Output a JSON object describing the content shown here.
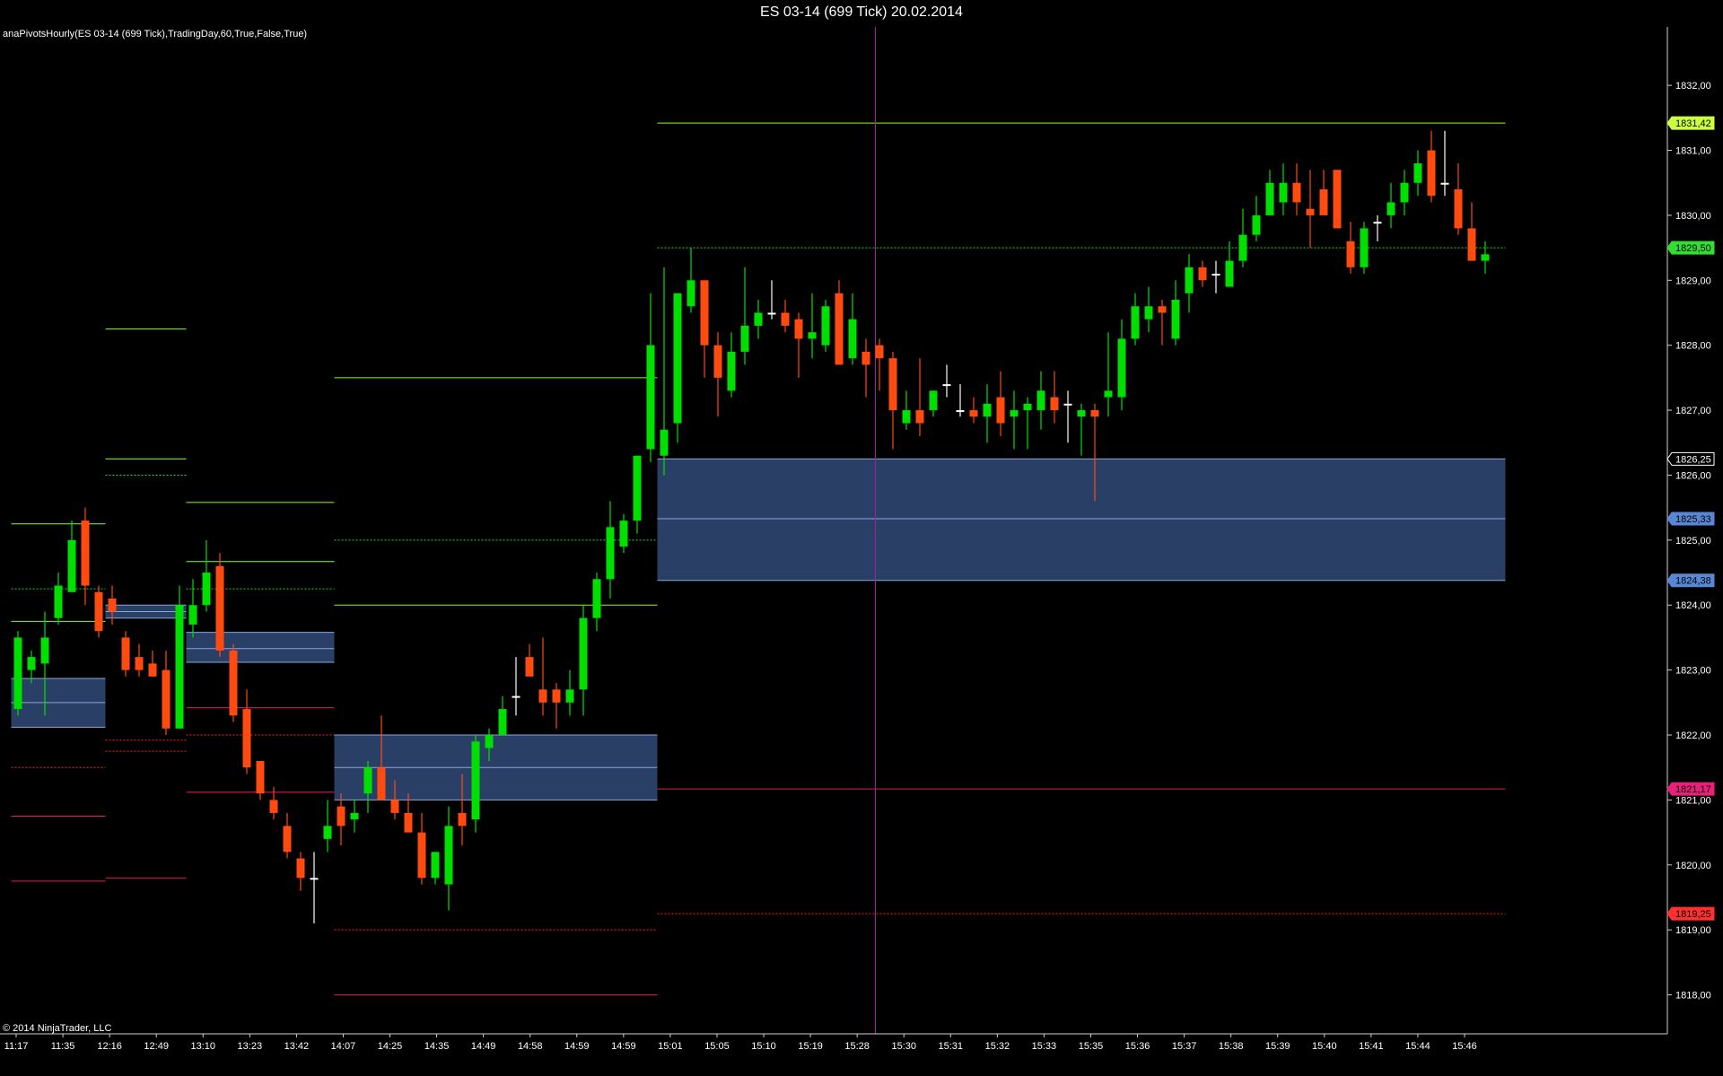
{
  "title": "ES 03-14 (699 Tick)  20.02.2014",
  "indicator_label": "anaPivotsHourly(ES 03-14 (699 Tick),TradingDay,60,True,False,True)",
  "copyright": "© 2014 NinjaTrader, LLC",
  "colors": {
    "background": "#000000",
    "up_candle": "#00e000",
    "down_candle": "#ff4a10",
    "doji": "#ffffff",
    "resistance": "#8cff1a",
    "pivot": "#22dd22",
    "support": "#e11b5f",
    "support_dotted": "#ff2222",
    "zone_fill": "#2a3f66",
    "zone_line": "#8aa6d8",
    "crosshair": "#a020a0"
  },
  "chart_data": {
    "type": "candlestick",
    "title": "ES 03-14 (699 Tick)  20.02.2014",
    "ylim": [
      1817.4,
      1832.9
    ],
    "y_ticks": [
      "1818,00",
      "1819,00",
      "1820,00",
      "1821,00",
      "1822,00",
      "1823,00",
      "1824,00",
      "1825,00",
      "1826,00",
      "1827,00",
      "1828,00",
      "1829,00",
      "1830,00",
      "1831,00",
      "1832,00"
    ],
    "x_ticks": [
      "11:17",
      "11:35",
      "12:16",
      "12:49",
      "13:10",
      "13:23",
      "13:42",
      "14:07",
      "14:25",
      "14:35",
      "14:49",
      "14:58",
      "14:59",
      "14:59",
      "15:01",
      "15:05",
      "15:10",
      "15:19",
      "15:28",
      "15:30",
      "15:31",
      "15:32",
      "15:33",
      "15:35",
      "15:36",
      "15:37",
      "15:38",
      "15:39",
      "15:40",
      "15:41",
      "15:44",
      "15:46"
    ],
    "price_markers": [
      {
        "label": "1831,42",
        "value": 1831.42,
        "bg": "#ccff44",
        "fg": "#000000"
      },
      {
        "label": "1829,50",
        "value": 1829.5,
        "bg": "#33dd33",
        "fg": "#000000"
      },
      {
        "label": "1826,25",
        "value": 1826.25,
        "bg": "#000000",
        "fg": "#ffffff"
      },
      {
        "label": "1825,33",
        "value": 1825.33,
        "bg": "#5a86d6",
        "fg": "#000000"
      },
      {
        "label": "1824,38",
        "value": 1824.38,
        "bg": "#5a86d6",
        "fg": "#000000"
      },
      {
        "label": "1821,17",
        "value": 1821.17,
        "bg": "#e8207a",
        "fg": "#000000"
      },
      {
        "label": "1819,25",
        "value": 1819.25,
        "bg": "#ff3030",
        "fg": "#000000"
      }
    ],
    "pivot_segments": [
      {
        "bars": [
          0,
          6
        ],
        "lines": [
          {
            "value": 1825.25,
            "kind": "resistance"
          },
          {
            "value": 1824.25,
            "kind": "pivot"
          },
          {
            "value": 1823.75,
            "kind": "resistance"
          },
          {
            "value": 1822.87,
            "kind": "zone"
          },
          {
            "value": 1822.5,
            "kind": "zone"
          },
          {
            "value": 1822.12,
            "kind": "zone"
          },
          {
            "value": 1821.5,
            "kind": "support_dotted"
          },
          {
            "value": 1820.75,
            "kind": "support"
          },
          {
            "value": 1819.75,
            "kind": "support"
          }
        ]
      },
      {
        "bars": [
          7,
          12
        ],
        "lines": [
          {
            "value": 1828.25,
            "kind": "resistance"
          },
          {
            "value": 1826.25,
            "kind": "resistance"
          },
          {
            "value": 1826.0,
            "kind": "pivot"
          },
          {
            "value": 1824.0,
            "kind": "zone"
          },
          {
            "value": 1823.9,
            "kind": "zone"
          },
          {
            "value": 1823.8,
            "kind": "zone"
          },
          {
            "value": 1821.92,
            "kind": "support_dotted"
          },
          {
            "value": 1821.75,
            "kind": "support_dotted"
          },
          {
            "value": 1819.8,
            "kind": "support"
          }
        ]
      },
      {
        "bars": [
          13,
          23
        ],
        "lines": [
          {
            "value": 1825.58,
            "kind": "resistance"
          },
          {
            "value": 1824.67,
            "kind": "resistance"
          },
          {
            "value": 1824.25,
            "kind": "pivot"
          },
          {
            "value": 1823.58,
            "kind": "zone"
          },
          {
            "value": 1823.33,
            "kind": "zone"
          },
          {
            "value": 1823.12,
            "kind": "zone"
          },
          {
            "value": 1822.42,
            "kind": "support"
          },
          {
            "value": 1822.0,
            "kind": "support_dotted"
          },
          {
            "value": 1821.12,
            "kind": "support"
          }
        ]
      },
      {
        "bars": [
          24,
          47
        ],
        "lines": [
          {
            "value": 1827.5,
            "kind": "resistance"
          },
          {
            "value": 1825.0,
            "kind": "pivot"
          },
          {
            "value": 1824.0,
            "kind": "resistance"
          },
          {
            "value": 1822.0,
            "kind": "zone"
          },
          {
            "value": 1821.5,
            "kind": "zone"
          },
          {
            "value": 1821.0,
            "kind": "zone"
          },
          {
            "value": 1819.0,
            "kind": "support_dotted"
          },
          {
            "value": 1818.0,
            "kind": "support"
          }
        ]
      },
      {
        "bars": [
          48,
          110
        ],
        "lines": [
          {
            "value": 1831.42,
            "kind": "resistance"
          },
          {
            "value": 1829.5,
            "kind": "pivot"
          },
          {
            "value": 1826.25,
            "kind": "zone"
          },
          {
            "value": 1825.33,
            "kind": "zone"
          },
          {
            "value": 1824.38,
            "kind": "zone"
          },
          {
            "value": 1821.17,
            "kind": "support"
          },
          {
            "value": 1819.25,
            "kind": "support_dotted"
          }
        ]
      }
    ],
    "crosshair_bar": 64,
    "candles": [
      {
        "o": 1822.4,
        "h": 1823.6,
        "l": 1822.3,
        "c": 1823.5
      },
      {
        "o": 1823.0,
        "h": 1823.3,
        "l": 1822.8,
        "c": 1823.2
      },
      {
        "o": 1823.1,
        "h": 1823.9,
        "l": 1822.3,
        "c": 1823.5
      },
      {
        "o": 1823.8,
        "h": 1824.5,
        "l": 1823.7,
        "c": 1824.3
      },
      {
        "o": 1824.2,
        "h": 1825.3,
        "l": 1824.2,
        "c": 1825.0
      },
      {
        "o": 1825.3,
        "h": 1825.5,
        "l": 1824.0,
        "c": 1824.3
      },
      {
        "o": 1824.2,
        "h": 1824.3,
        "l": 1823.5,
        "c": 1823.6
      },
      {
        "o": 1824.1,
        "h": 1824.3,
        "l": 1823.7,
        "c": 1823.9
      },
      {
        "o": 1823.5,
        "h": 1823.6,
        "l": 1822.9,
        "c": 1823.0
      },
      {
        "o": 1823.2,
        "h": 1823.4,
        "l": 1822.9,
        "c": 1823.0
      },
      {
        "o": 1823.1,
        "h": 1823.3,
        "l": 1822.9,
        "c": 1822.9
      },
      {
        "o": 1823.0,
        "h": 1823.3,
        "l": 1822.0,
        "c": 1822.1
      },
      {
        "o": 1822.1,
        "h": 1824.3,
        "l": 1822.1,
        "c": 1824.0
      },
      {
        "o": 1823.7,
        "h": 1824.4,
        "l": 1823.5,
        "c": 1824.0
      },
      {
        "o": 1824.0,
        "h": 1825.0,
        "l": 1823.9,
        "c": 1824.5
      },
      {
        "o": 1824.6,
        "h": 1824.8,
        "l": 1823.2,
        "c": 1823.3
      },
      {
        "o": 1823.3,
        "h": 1823.4,
        "l": 1822.2,
        "c": 1822.3
      },
      {
        "o": 1822.4,
        "h": 1822.7,
        "l": 1821.4,
        "c": 1821.5
      },
      {
        "o": 1821.6,
        "h": 1821.6,
        "l": 1821.0,
        "c": 1821.1
      },
      {
        "o": 1821.0,
        "h": 1821.2,
        "l": 1820.7,
        "c": 1820.8
      },
      {
        "o": 1820.6,
        "h": 1820.8,
        "l": 1820.1,
        "c": 1820.2
      },
      {
        "o": 1820.1,
        "h": 1820.2,
        "l": 1819.6,
        "c": 1819.8
      },
      {
        "o": 1819.8,
        "h": 1820.2,
        "l": 1819.1,
        "c": 1819.8
      },
      {
        "o": 1820.4,
        "h": 1821.0,
        "l": 1820.2,
        "c": 1820.6
      },
      {
        "o": 1820.9,
        "h": 1821.1,
        "l": 1820.3,
        "c": 1820.6
      },
      {
        "o": 1820.7,
        "h": 1821.0,
        "l": 1820.5,
        "c": 1820.8
      },
      {
        "o": 1821.1,
        "h": 1821.6,
        "l": 1820.8,
        "c": 1821.5
      },
      {
        "o": 1821.5,
        "h": 1822.3,
        "l": 1821.0,
        "c": 1821.0
      },
      {
        "o": 1821.0,
        "h": 1821.3,
        "l": 1820.7,
        "c": 1820.8
      },
      {
        "o": 1820.8,
        "h": 1821.1,
        "l": 1820.5,
        "c": 1820.5
      },
      {
        "o": 1820.5,
        "h": 1820.8,
        "l": 1819.7,
        "c": 1819.8
      },
      {
        "o": 1819.8,
        "h": 1820.2,
        "l": 1819.7,
        "c": 1820.2
      },
      {
        "o": 1819.7,
        "h": 1820.9,
        "l": 1819.3,
        "c": 1820.6
      },
      {
        "o": 1820.8,
        "h": 1821.4,
        "l": 1820.3,
        "c": 1820.6
      },
      {
        "o": 1820.7,
        "h": 1822.0,
        "l": 1820.5,
        "c": 1821.9
      },
      {
        "o": 1821.8,
        "h": 1822.1,
        "l": 1821.6,
        "c": 1822.0
      },
      {
        "o": 1822.0,
        "h": 1822.6,
        "l": 1822.0,
        "c": 1822.4
      },
      {
        "o": 1822.6,
        "h": 1823.2,
        "l": 1822.3,
        "c": 1822.6
      },
      {
        "o": 1823.2,
        "h": 1823.4,
        "l": 1822.9,
        "c": 1822.9
      },
      {
        "o": 1822.7,
        "h": 1823.5,
        "l": 1822.3,
        "c": 1822.5
      },
      {
        "o": 1822.7,
        "h": 1822.8,
        "l": 1822.1,
        "c": 1822.5
      },
      {
        "o": 1822.5,
        "h": 1823.0,
        "l": 1822.3,
        "c": 1822.7
      },
      {
        "o": 1822.7,
        "h": 1824.0,
        "l": 1822.3,
        "c": 1823.8
      },
      {
        "o": 1823.8,
        "h": 1824.5,
        "l": 1823.6,
        "c": 1824.4
      },
      {
        "o": 1824.4,
        "h": 1825.6,
        "l": 1824.1,
        "c": 1825.2
      },
      {
        "o": 1824.9,
        "h": 1825.4,
        "l": 1824.8,
        "c": 1825.3
      },
      {
        "o": 1825.3,
        "h": 1826.3,
        "l": 1825.1,
        "c": 1826.3
      },
      {
        "o": 1826.4,
        "h": 1828.8,
        "l": 1826.2,
        "c": 1828.0
      },
      {
        "o": 1826.3,
        "h": 1829.2,
        "l": 1826.0,
        "c": 1826.7
      },
      {
        "o": 1826.8,
        "h": 1828.8,
        "l": 1826.5,
        "c": 1828.8
      },
      {
        "o": 1828.6,
        "h": 1829.5,
        "l": 1828.5,
        "c": 1829.0
      },
      {
        "o": 1829.0,
        "h": 1829.0,
        "l": 1827.5,
        "c": 1828.0
      },
      {
        "o": 1828.0,
        "h": 1828.2,
        "l": 1826.9,
        "c": 1827.5
      },
      {
        "o": 1827.3,
        "h": 1828.2,
        "l": 1827.2,
        "c": 1827.9
      },
      {
        "o": 1827.9,
        "h": 1829.2,
        "l": 1827.7,
        "c": 1828.3
      },
      {
        "o": 1828.3,
        "h": 1828.7,
        "l": 1828.1,
        "c": 1828.5
      },
      {
        "o": 1828.5,
        "h": 1829.0,
        "l": 1828.4,
        "c": 1828.5
      },
      {
        "o": 1828.5,
        "h": 1828.7,
        "l": 1828.2,
        "c": 1828.3
      },
      {
        "o": 1828.4,
        "h": 1828.5,
        "l": 1827.5,
        "c": 1828.1
      },
      {
        "o": 1828.1,
        "h": 1828.8,
        "l": 1827.8,
        "c": 1828.2
      },
      {
        "o": 1828.0,
        "h": 1828.7,
        "l": 1827.9,
        "c": 1828.6
      },
      {
        "o": 1828.8,
        "h": 1829.0,
        "l": 1827.7,
        "c": 1827.7
      },
      {
        "o": 1827.8,
        "h": 1828.8,
        "l": 1827.7,
        "c": 1828.4
      },
      {
        "o": 1827.9,
        "h": 1828.1,
        "l": 1827.2,
        "c": 1827.7
      },
      {
        "o": 1828.0,
        "h": 1828.1,
        "l": 1827.3,
        "c": 1827.8
      },
      {
        "o": 1827.8,
        "h": 1827.9,
        "l": 1826.4,
        "c": 1827.0
      },
      {
        "o": 1826.8,
        "h": 1827.3,
        "l": 1826.7,
        "c": 1827.0
      },
      {
        "o": 1827.0,
        "h": 1827.8,
        "l": 1826.6,
        "c": 1826.8
      },
      {
        "o": 1827.0,
        "h": 1827.3,
        "l": 1826.9,
        "c": 1827.3
      },
      {
        "o": 1827.4,
        "h": 1827.7,
        "l": 1827.2,
        "c": 1827.4
      },
      {
        "o": 1827.0,
        "h": 1827.4,
        "l": 1826.9,
        "c": 1827.0
      },
      {
        "o": 1827.0,
        "h": 1827.2,
        "l": 1826.8,
        "c": 1826.9
      },
      {
        "o": 1826.9,
        "h": 1827.4,
        "l": 1826.5,
        "c": 1827.1
      },
      {
        "o": 1827.2,
        "h": 1827.6,
        "l": 1826.6,
        "c": 1826.8
      },
      {
        "o": 1826.9,
        "h": 1827.3,
        "l": 1826.4,
        "c": 1827.0
      },
      {
        "o": 1827.0,
        "h": 1827.2,
        "l": 1826.4,
        "c": 1827.1
      },
      {
        "o": 1827.0,
        "h": 1827.6,
        "l": 1826.7,
        "c": 1827.3
      },
      {
        "o": 1827.2,
        "h": 1827.6,
        "l": 1826.8,
        "c": 1827.0
      },
      {
        "o": 1827.1,
        "h": 1827.3,
        "l": 1826.5,
        "c": 1827.1
      },
      {
        "o": 1826.9,
        "h": 1827.1,
        "l": 1826.3,
        "c": 1827.0
      },
      {
        "o": 1827.0,
        "h": 1827.1,
        "l": 1825.6,
        "c": 1826.9
      },
      {
        "o": 1827.2,
        "h": 1828.2,
        "l": 1826.9,
        "c": 1827.3
      },
      {
        "o": 1827.2,
        "h": 1828.4,
        "l": 1827.0,
        "c": 1828.1
      },
      {
        "o": 1828.1,
        "h": 1828.8,
        "l": 1828.0,
        "c": 1828.6
      },
      {
        "o": 1828.4,
        "h": 1828.9,
        "l": 1828.2,
        "c": 1828.6
      },
      {
        "o": 1828.6,
        "h": 1828.7,
        "l": 1828.0,
        "c": 1828.5
      },
      {
        "o": 1828.1,
        "h": 1829.0,
        "l": 1828.0,
        "c": 1828.7
      },
      {
        "o": 1828.8,
        "h": 1829.4,
        "l": 1828.5,
        "c": 1829.2
      },
      {
        "o": 1829.2,
        "h": 1829.3,
        "l": 1828.9,
        "c": 1829.0
      },
      {
        "o": 1829.1,
        "h": 1829.3,
        "l": 1828.8,
        "c": 1829.1
      },
      {
        "o": 1828.9,
        "h": 1829.6,
        "l": 1828.9,
        "c": 1829.3
      },
      {
        "o": 1829.3,
        "h": 1830.1,
        "l": 1829.2,
        "c": 1829.7
      },
      {
        "o": 1829.7,
        "h": 1830.3,
        "l": 1829.6,
        "c": 1830.0
      },
      {
        "o": 1830.0,
        "h": 1830.7,
        "l": 1830.0,
        "c": 1830.5
      },
      {
        "o": 1830.2,
        "h": 1830.8,
        "l": 1830.0,
        "c": 1830.5
      },
      {
        "o": 1830.5,
        "h": 1830.8,
        "l": 1830.0,
        "c": 1830.2
      },
      {
        "o": 1830.1,
        "h": 1830.7,
        "l": 1829.5,
        "c": 1830.0
      },
      {
        "o": 1830.4,
        "h": 1830.7,
        "l": 1830.0,
        "c": 1830.0
      },
      {
        "o": 1830.7,
        "h": 1830.7,
        "l": 1829.8,
        "c": 1829.8
      },
      {
        "o": 1829.6,
        "h": 1829.9,
        "l": 1829.1,
        "c": 1829.2
      },
      {
        "o": 1829.2,
        "h": 1829.9,
        "l": 1829.1,
        "c": 1829.8
      },
      {
        "o": 1829.9,
        "h": 1830.0,
        "l": 1829.6,
        "c": 1829.9
      },
      {
        "o": 1830.0,
        "h": 1830.5,
        "l": 1829.8,
        "c": 1830.2
      },
      {
        "o": 1830.2,
        "h": 1830.7,
        "l": 1830.0,
        "c": 1830.5
      },
      {
        "o": 1830.5,
        "h": 1831.0,
        "l": 1830.3,
        "c": 1830.8
      },
      {
        "o": 1831.0,
        "h": 1831.3,
        "l": 1830.2,
        "c": 1830.3
      },
      {
        "o": 1830.5,
        "h": 1831.3,
        "l": 1830.3,
        "c": 1830.5
      },
      {
        "o": 1830.4,
        "h": 1830.8,
        "l": 1829.7,
        "c": 1829.8
      },
      {
        "o": 1829.8,
        "h": 1830.2,
        "l": 1829.3,
        "c": 1829.3
      },
      {
        "o": 1829.3,
        "h": 1829.6,
        "l": 1829.1,
        "c": 1829.4
      }
    ]
  }
}
